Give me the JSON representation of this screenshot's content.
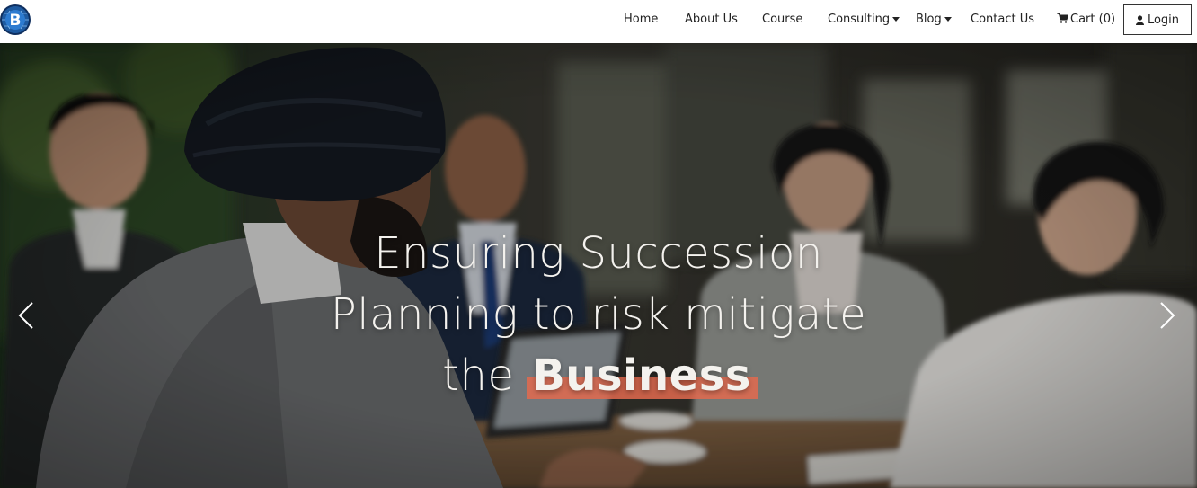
{
  "brand": {
    "logo_letter": "B",
    "accent_color": "#1e5aa0"
  },
  "nav": {
    "items": [
      {
        "label": "Home"
      },
      {
        "label": "About Us"
      },
      {
        "label": "Course"
      },
      {
        "label": "Consulting",
        "dropdown": true
      },
      {
        "label": "Blog",
        "dropdown": true
      },
      {
        "label": "Contact Us"
      }
    ],
    "cart_label": "Cart (0)",
    "cart_icon": "shopping-cart-icon",
    "login_label": "Login",
    "login_icon": "user-icon"
  },
  "hero": {
    "heading_line1": "Ensuring Succession",
    "heading_line2": "Planning to risk mitigate",
    "heading_line3_prefix": "the",
    "heading_line3_highlight": "Business",
    "highlight_color": "#e36a4f",
    "prev_icon": "chevron-left-icon",
    "next_icon": "chevron-right-icon"
  }
}
